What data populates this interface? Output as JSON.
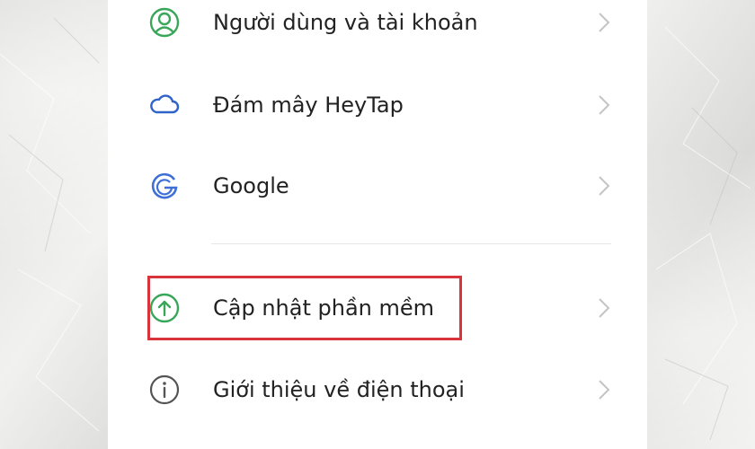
{
  "settings": {
    "items": [
      {
        "label": "Người dùng và tài khoản",
        "icon": "user-account-icon",
        "icon_color": "#3aa65a"
      },
      {
        "label": "Đám mây HeyTap",
        "icon": "cloud-icon",
        "icon_color": "#2f63c9"
      },
      {
        "label": "Google",
        "icon": "google-icon",
        "icon_color": "#3d6fd6"
      },
      {
        "label": "Cập nhật phần mềm",
        "icon": "software-update-icon",
        "icon_color": "#3aa65a"
      },
      {
        "label": "Giới thiệu về điện thoại",
        "icon": "info-icon",
        "icon_color": "#555555"
      }
    ]
  },
  "colors": {
    "highlight_border": "#d9343c",
    "chevron": "#c4c4c4",
    "text": "#222222"
  }
}
